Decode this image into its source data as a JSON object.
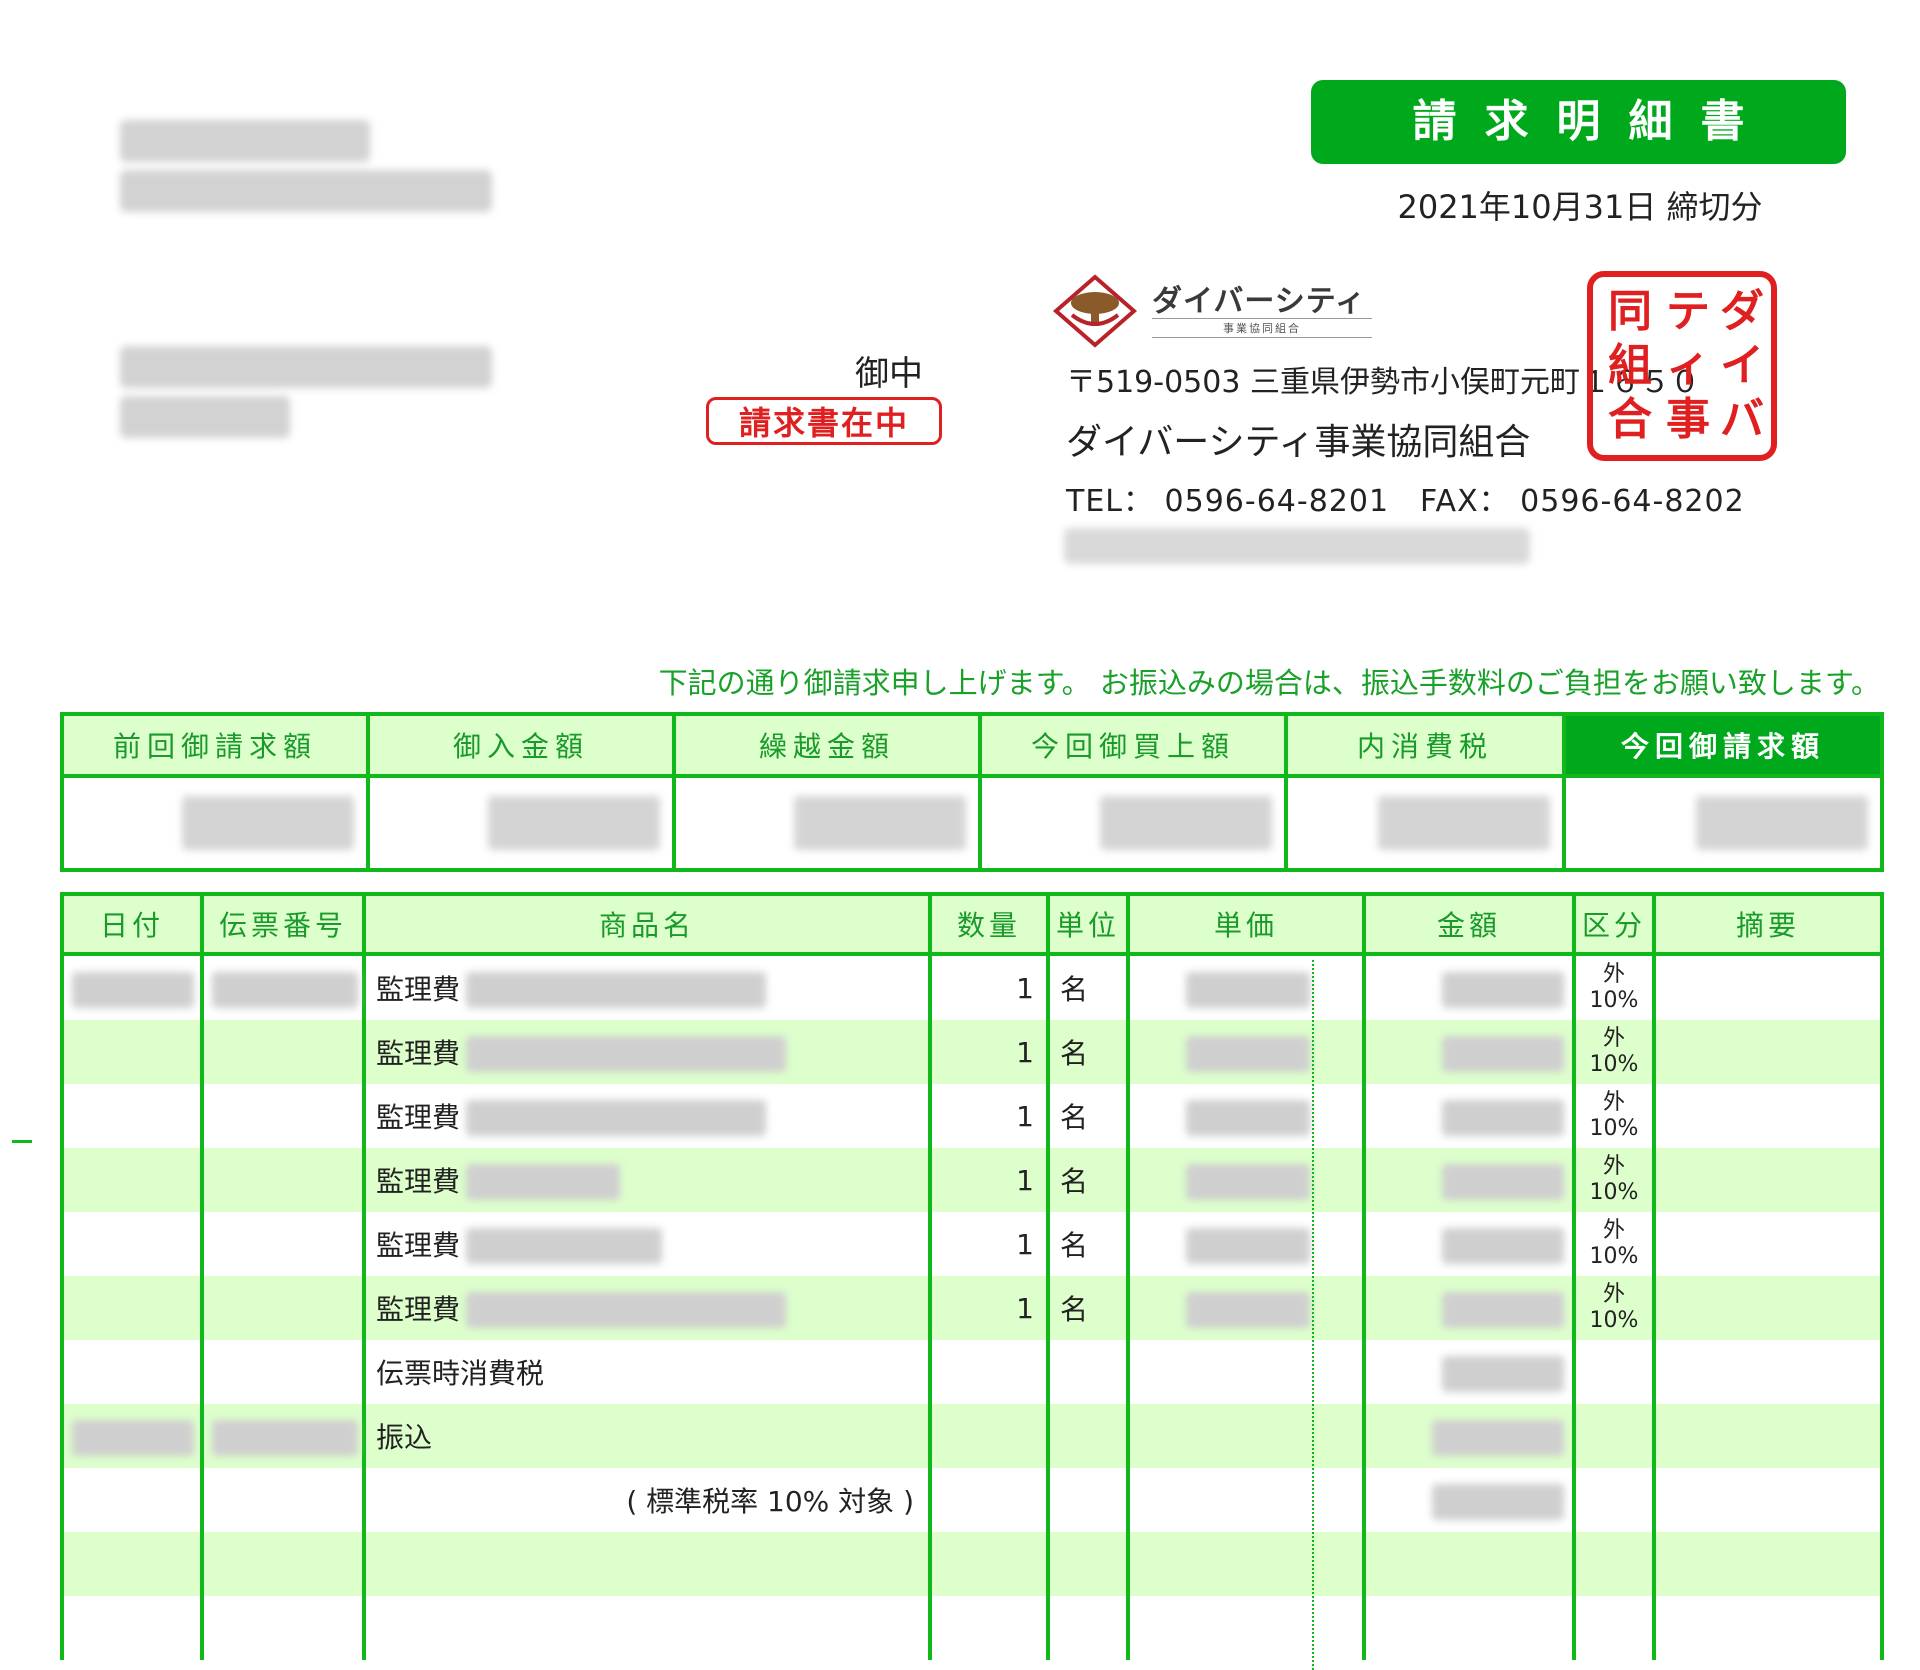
{
  "header": {
    "title": "請求明細書",
    "closing_date": "2021年10月31日 締切分",
    "recipient_suffix": "御中",
    "enclosed_stamp": "請求書在中"
  },
  "company": {
    "logo_name": "ダイバーシティ",
    "logo_subtitle": "事業協同組合",
    "address": "〒519-0503 三重県伊勢市小俣町元町１６５０",
    "name": "ダイバーシティ事業協同組合",
    "phone_line": "TEL： 0596-64-8201　FAX： 0596-64-8202",
    "seal_text": "ダイバーシティ事業協同組合之印"
  },
  "notice": "下記の通り御請求申し上げます。 お振込みの場合は、振込手数料のご負担をお願い致します。",
  "summary": {
    "headers": [
      "前回御請求額",
      "御入金額",
      "繰越金額",
      "今回御買上額",
      "内消費税",
      "今回御請求額"
    ]
  },
  "detail": {
    "headers": [
      "日付",
      "伝票番号",
      "商品名",
      "数量",
      "単位",
      "単価",
      "金額",
      "区分",
      "摘要"
    ],
    "rows": [
      {
        "item": "監理費",
        "qty": "1",
        "unit": "名",
        "tax_class": "外",
        "tax_rate": "10%"
      },
      {
        "item": "監理費",
        "qty": "1",
        "unit": "名",
        "tax_class": "外",
        "tax_rate": "10%"
      },
      {
        "item": "監理費",
        "qty": "1",
        "unit": "名",
        "tax_class": "外",
        "tax_rate": "10%"
      },
      {
        "item": "監理費",
        "qty": "1",
        "unit": "名",
        "tax_class": "外",
        "tax_rate": "10%"
      },
      {
        "item": "監理費",
        "qty": "1",
        "unit": "名",
        "tax_class": "外",
        "tax_rate": "10%"
      },
      {
        "item": "監理費",
        "qty": "1",
        "unit": "名",
        "tax_class": "外",
        "tax_rate": "10%"
      }
    ],
    "slip_tax_label": "伝票時消費税",
    "transfer_label": "振込",
    "tax_note": "( 標準税率 10% 対象 )"
  },
  "colors": {
    "accent_green": "#00a81c",
    "header_fill": "#dcffcc",
    "stamp_red": "#e02020"
  }
}
